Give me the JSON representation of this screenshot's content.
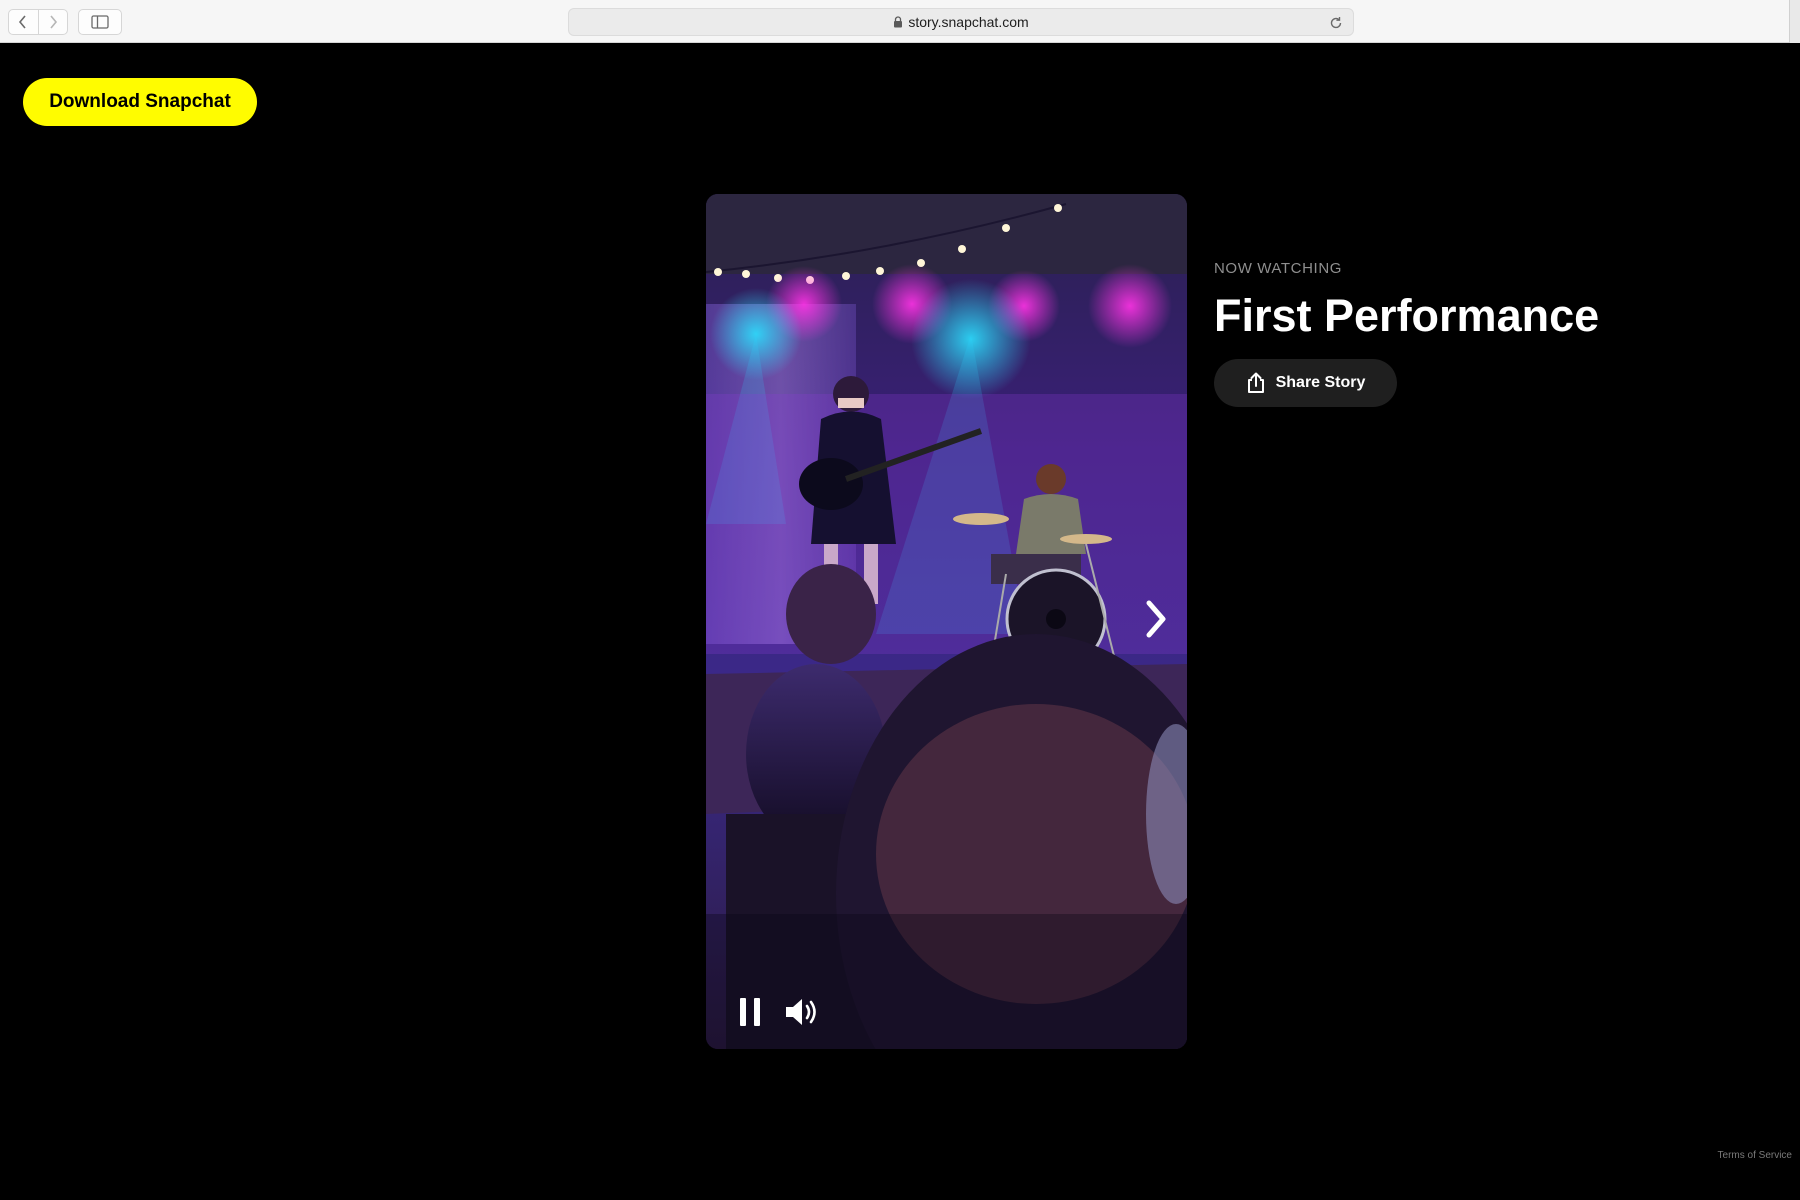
{
  "browser": {
    "url": "story.snapchat.com"
  },
  "header": {
    "download_label": "Download Snapchat",
    "accent_color": "#fffc00"
  },
  "story": {
    "eyebrow": "NOW WATCHING",
    "title": "First Performance",
    "share_label": "Share Story"
  },
  "player": {
    "state": "playing",
    "controls": [
      "pause-icon",
      "volume-icon",
      "chevron-right-icon"
    ]
  },
  "footer": {
    "terms_label": "Terms of Service"
  }
}
